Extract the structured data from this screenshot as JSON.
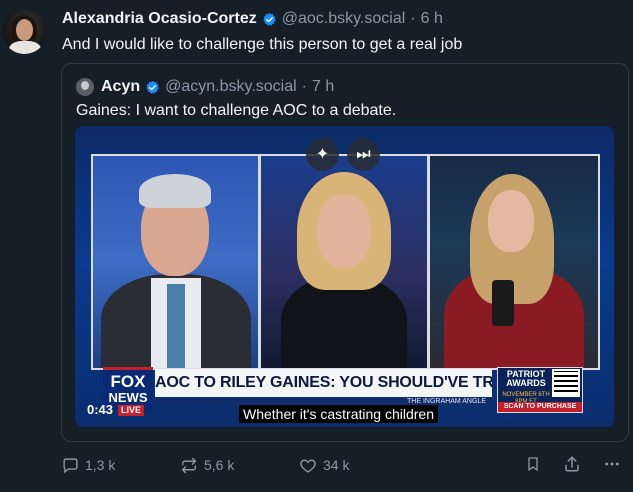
{
  "post": {
    "author_name": "Alexandria Ocasio-Cortez",
    "author_handle": "@aoc.bsky.social",
    "separator": "·",
    "time": "6 h",
    "text": "And I would like to challenge this person to get a real job"
  },
  "quoted_post": {
    "author_name": "Acyn",
    "author_handle": "@acyn.bsky.social",
    "separator": "·",
    "time": "7 h",
    "text": "Gaines: I want to challenge AOC to a debate."
  },
  "video": {
    "network_logo_line1": "FOX",
    "network_logo_line2": "NEWS",
    "headline": "AOC TO RILEY GAINES: YOU SHOULD'VE TRAINED HARDER",
    "sub_banner": "THE INGRAHAM ANGLE",
    "promo_title": "PATRIOT AWARDS",
    "promo_date": "NOVEMBER 6TH 8PM ET",
    "promo_cta": "SCAN TO PURCHASE",
    "timestamp": "0:43",
    "live_label": "LIVE",
    "caption": "Whether it's castrating children",
    "controls": [
      "sparkle-icon",
      "skip-next-icon"
    ]
  },
  "actions": {
    "replies": "1,3 k",
    "reposts": "5,6 k",
    "likes": "34 k"
  },
  "colors": {
    "background": "#161e27",
    "text": "#f1f3f5",
    "muted": "#8b98a5",
    "verified": "#1a8cff",
    "border": "#2e3a46"
  }
}
